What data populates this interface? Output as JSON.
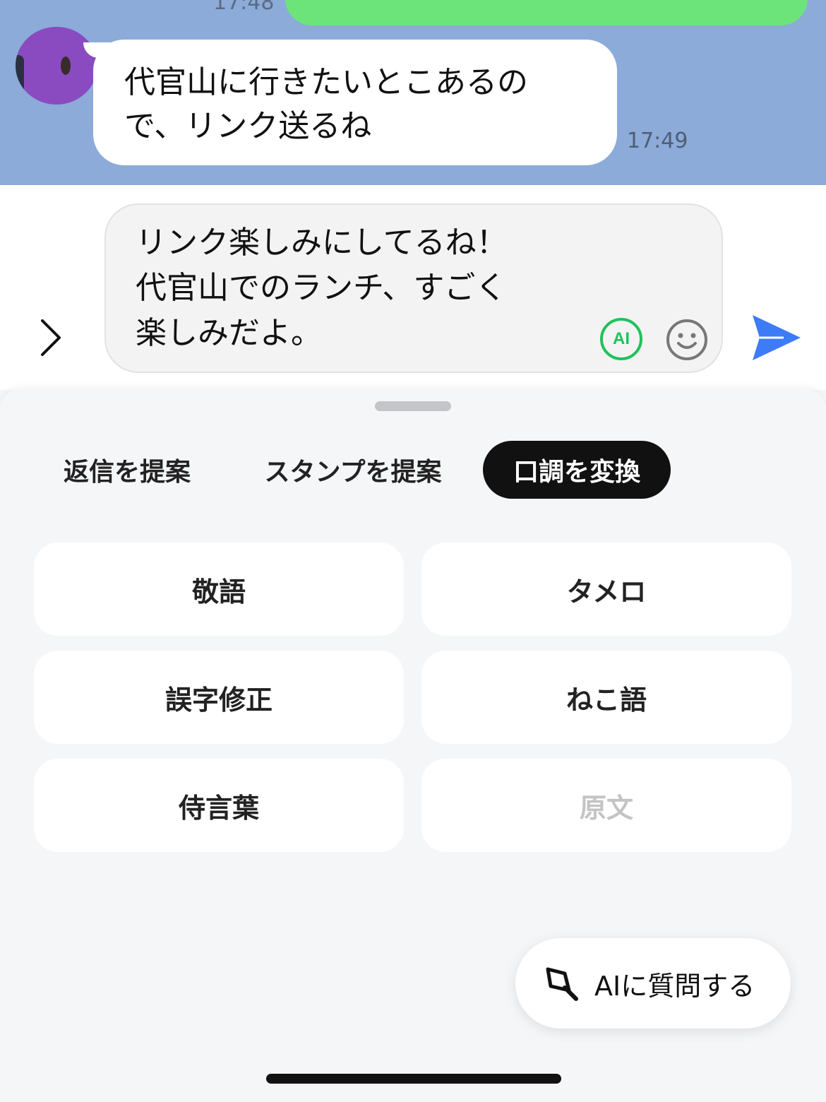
{
  "chat": {
    "previous_time": "17:48",
    "incoming_message": "代官山に行きたいとこあるので、リンク送るね",
    "incoming_time": "17:49"
  },
  "composer": {
    "text": "リンク楽しみにしてるね！\n代官山でのランチ、すごく\n楽しみだよ。",
    "ai_badge": "AI"
  },
  "tabs": [
    {
      "label": "返信を提案",
      "active": false
    },
    {
      "label": "スタンプを提案",
      "active": false
    },
    {
      "label": "口調を変換",
      "active": true
    }
  ],
  "tone_options": [
    {
      "label": "敬語",
      "enabled": true
    },
    {
      "label": "タメロ",
      "enabled": true
    },
    {
      "label": "誤字修正",
      "enabled": true
    },
    {
      "label": "ねこ語",
      "enabled": true
    },
    {
      "label": "侍言葉",
      "enabled": true
    },
    {
      "label": "原文",
      "enabled": false
    }
  ],
  "ask_ai": {
    "label": "AIに質問する"
  },
  "colors": {
    "chat_background": "#8cabd9",
    "outgoing_bubble": "#6de47a",
    "ai_green": "#1fc25a",
    "send_blue": "#3d7bf7",
    "active_tab": "#111111"
  }
}
